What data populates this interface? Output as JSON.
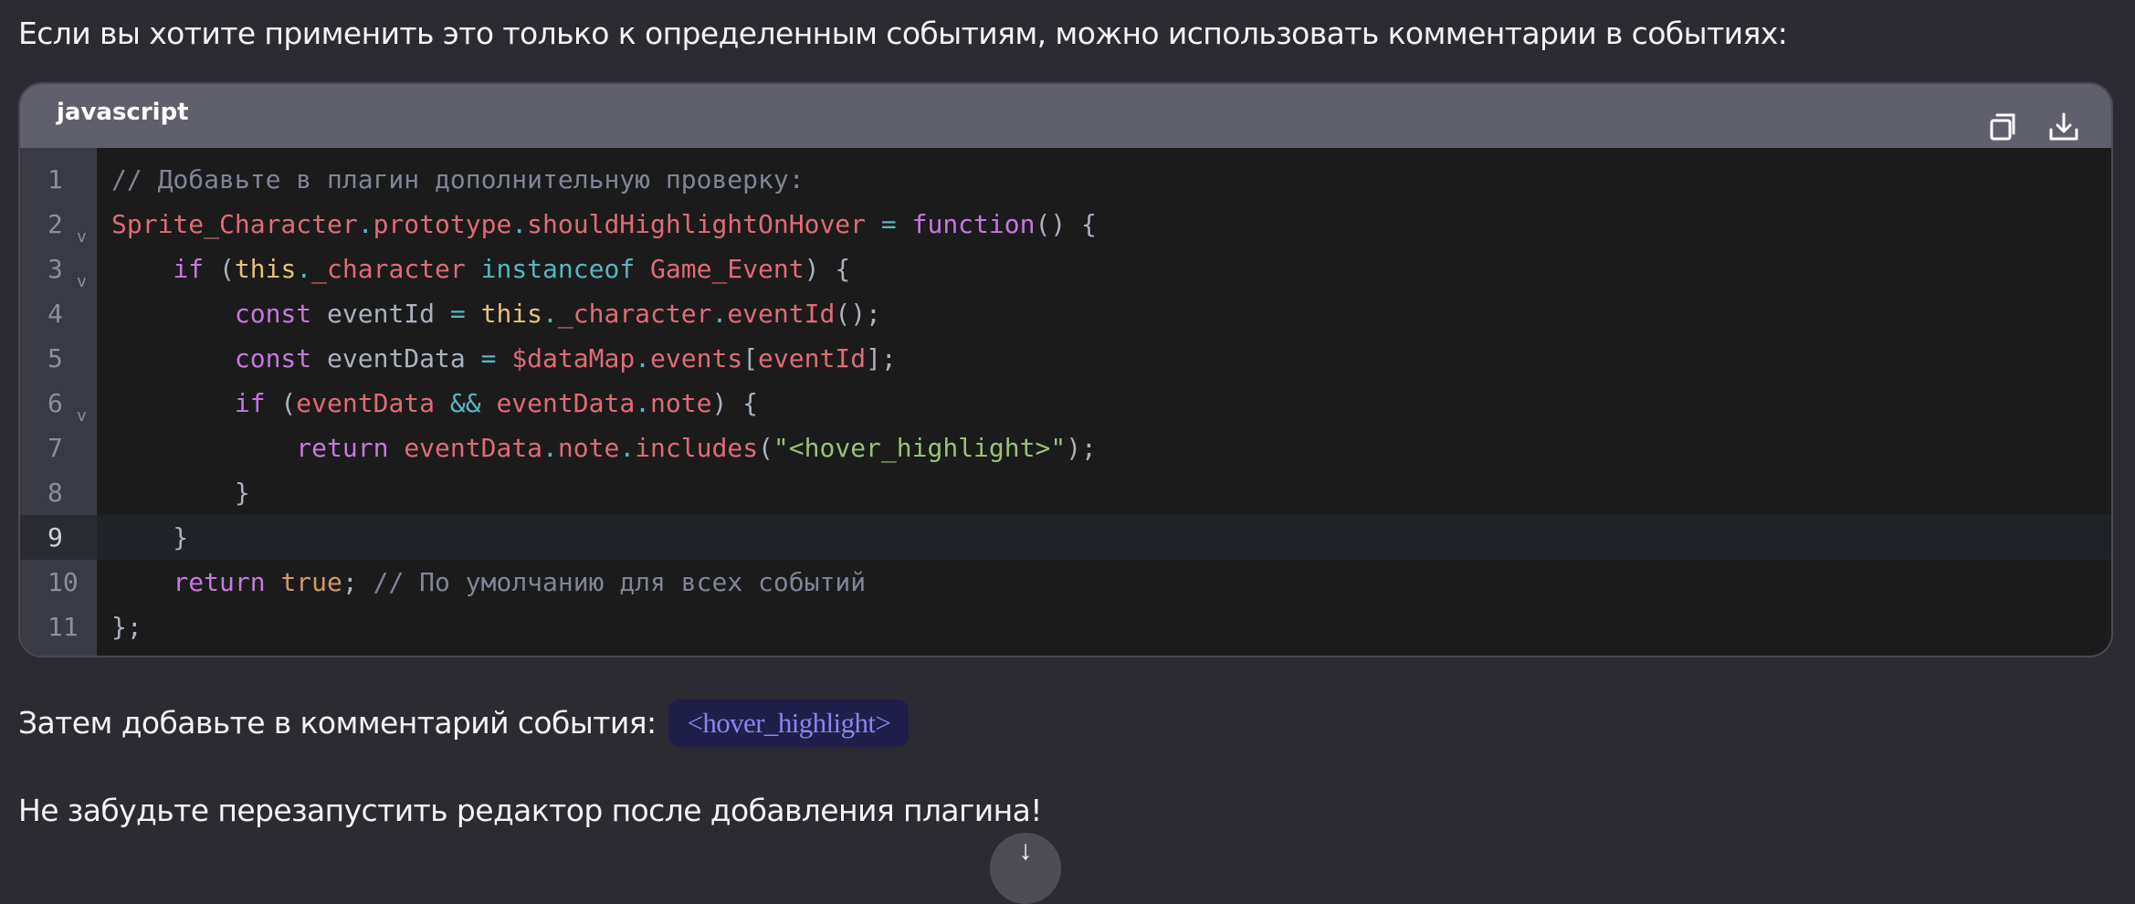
{
  "intro_text": "Если вы хотите применить это только к определенным событиям, можно использовать комментарии в событиях:",
  "code_block": {
    "language": "javascript",
    "copy_icon": "copy-icon",
    "download_icon": "download-icon",
    "active_line": 9,
    "lines": [
      {
        "n": "1",
        "fold": false,
        "tokens": [
          [
            "comment",
            "// Добавьте в плагин дополнительную проверку:"
          ]
        ]
      },
      {
        "n": "2",
        "fold": true,
        "tokens": [
          [
            "red",
            "Sprite_Character"
          ],
          [
            "cyan",
            "."
          ],
          [
            "red",
            "prototype"
          ],
          [
            "cyan",
            "."
          ],
          [
            "red",
            "shouldHighlightOnHover"
          ],
          [
            "plain",
            " "
          ],
          [
            "cyan",
            "="
          ],
          [
            "plain",
            " "
          ],
          [
            "purple",
            "function"
          ],
          [
            "plain",
            "() {"
          ]
        ]
      },
      {
        "n": "3",
        "fold": true,
        "tokens": [
          [
            "plain",
            "    "
          ],
          [
            "purple",
            "if"
          ],
          [
            "plain",
            " ("
          ],
          [
            "yellow",
            "this"
          ],
          [
            "cyan",
            "."
          ],
          [
            "red",
            "_character"
          ],
          [
            "plain",
            " "
          ],
          [
            "cyan",
            "instanceof"
          ],
          [
            "plain",
            " "
          ],
          [
            "red",
            "Game_Event"
          ],
          [
            "plain",
            ") {"
          ]
        ]
      },
      {
        "n": "4",
        "fold": false,
        "tokens": [
          [
            "plain",
            "        "
          ],
          [
            "purple",
            "const"
          ],
          [
            "plain",
            " eventId "
          ],
          [
            "cyan",
            "="
          ],
          [
            "plain",
            " "
          ],
          [
            "yellow",
            "this"
          ],
          [
            "cyan",
            "."
          ],
          [
            "red",
            "_character"
          ],
          [
            "cyan",
            "."
          ],
          [
            "red",
            "eventId"
          ],
          [
            "plain",
            "();"
          ]
        ]
      },
      {
        "n": "5",
        "fold": false,
        "tokens": [
          [
            "plain",
            "        "
          ],
          [
            "purple",
            "const"
          ],
          [
            "plain",
            " eventData "
          ],
          [
            "cyan",
            "="
          ],
          [
            "plain",
            " "
          ],
          [
            "red",
            "$dataMap"
          ],
          [
            "cyan",
            "."
          ],
          [
            "red",
            "events"
          ],
          [
            "plain",
            "["
          ],
          [
            "red",
            "eventId"
          ],
          [
            "plain",
            "];"
          ]
        ]
      },
      {
        "n": "6",
        "fold": true,
        "tokens": [
          [
            "plain",
            "        "
          ],
          [
            "purple",
            "if"
          ],
          [
            "plain",
            " ("
          ],
          [
            "red",
            "eventData"
          ],
          [
            "plain",
            " "
          ],
          [
            "cyan",
            "&&"
          ],
          [
            "plain",
            " "
          ],
          [
            "red",
            "eventData"
          ],
          [
            "cyan",
            "."
          ],
          [
            "red",
            "note"
          ],
          [
            "plain",
            ") {"
          ]
        ]
      },
      {
        "n": "7",
        "fold": false,
        "tokens": [
          [
            "plain",
            "            "
          ],
          [
            "purple",
            "return"
          ],
          [
            "plain",
            " "
          ],
          [
            "red",
            "eventData"
          ],
          [
            "cyan",
            "."
          ],
          [
            "red",
            "note"
          ],
          [
            "cyan",
            "."
          ],
          [
            "red",
            "includes"
          ],
          [
            "plain",
            "("
          ],
          [
            "green",
            "\"<hover_highlight>\""
          ],
          [
            "plain",
            ");"
          ]
        ]
      },
      {
        "n": "8",
        "fold": false,
        "tokens": [
          [
            "plain",
            "        }"
          ]
        ]
      },
      {
        "n": "9",
        "fold": false,
        "tokens": [
          [
            "plain",
            "    }"
          ]
        ]
      },
      {
        "n": "10",
        "fold": false,
        "tokens": [
          [
            "plain",
            "    "
          ],
          [
            "purple",
            "return"
          ],
          [
            "plain",
            " "
          ],
          [
            "orange",
            "true"
          ],
          [
            "plain",
            "; "
          ],
          [
            "comment",
            "// По умолчанию для всех событий"
          ]
        ]
      },
      {
        "n": "11",
        "fold": false,
        "tokens": [
          [
            "plain",
            "};"
          ]
        ]
      }
    ]
  },
  "followup_text": "Затем добавьте в комментарий события:",
  "inline_code": "<hover_highlight>",
  "closing_text": "Не забудьте перезапустить редактор после добавления плагина!",
  "fold_glyph": "v",
  "scroll_button_glyph": "↓"
}
